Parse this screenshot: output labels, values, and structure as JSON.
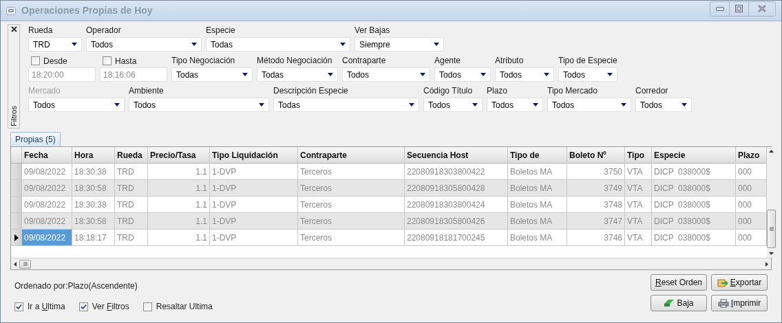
{
  "window": {
    "title": "Operaciones Propias de Hoy"
  },
  "filters": {
    "panel_label": "Filtros",
    "top_row": [
      {
        "kind": "combo",
        "label": "Rueda",
        "value": "TRD"
      },
      {
        "kind": "combo",
        "label": "Operador",
        "value": "Todos"
      },
      {
        "kind": "combo",
        "label": "Especie",
        "value": "Todas"
      },
      {
        "kind": "combo",
        "label": "Ver Bajas",
        "value": "Siempre"
      }
    ],
    "middle_row": [
      {
        "kind": "time",
        "label": "Desde",
        "value": "18:20:00",
        "checked": false
      },
      {
        "kind": "time",
        "label": "Hasta",
        "value": "18:16:06",
        "checked": false
      },
      {
        "kind": "combo",
        "label": "Tipo Negociación",
        "value": "Todas"
      },
      {
        "kind": "combo",
        "label": "Método Negociación",
        "value": "Todas"
      },
      {
        "kind": "combo",
        "label": "Contraparte",
        "value": "Todos"
      },
      {
        "kind": "combo",
        "label": "Agente",
        "value": "Todos"
      },
      {
        "kind": "combo",
        "label": "Atributo",
        "value": "Todos"
      },
      {
        "kind": "combo",
        "label": "Tipo de Especie",
        "value": "Todos"
      }
    ],
    "bottom_row": [
      {
        "kind": "combo",
        "label": "Mercado",
        "value": "Todos",
        "disabled": true
      },
      {
        "kind": "combo",
        "label": "Ambiente",
        "value": "Todos",
        "disabled": false
      },
      {
        "kind": "combo",
        "label": "Descripción Especie",
        "value": "Todas",
        "disabled": false
      },
      {
        "kind": "combo",
        "label": "Código Título",
        "value": "Todos",
        "disabled": false
      },
      {
        "kind": "combo",
        "label": "Plazo",
        "value": "Todos",
        "disabled": false
      },
      {
        "kind": "combo",
        "label": "Tipo Mercado",
        "value": "Todos",
        "disabled": false
      },
      {
        "kind": "combo",
        "label": "Corredor",
        "value": "Todos",
        "disabled": false
      }
    ]
  },
  "tabs": [
    {
      "label": "Propias (5)",
      "selected": true
    }
  ],
  "table": {
    "columns": [
      "Fecha",
      "Hora",
      "Rueda",
      "Precio/Tasa",
      "Tipo Liquidación",
      "Contraparte",
      "Secuencia Host",
      "Tipo de",
      "Boleto Nº",
      "Tipo",
      "Especie",
      "Plazo"
    ],
    "rows": [
      {
        "current": false,
        "cells": [
          "09/08/2022",
          "18:30:38",
          "TRD",
          "1.1",
          "1-DVP",
          "Terceros",
          "22080918303800422",
          "Boletos MA",
          "3750",
          "VTA",
          "DICP  038000$",
          "000"
        ]
      },
      {
        "current": false,
        "cells": [
          "09/08/2022",
          "18:30:58",
          "TRD",
          "1.1",
          "1-DVP",
          "Terceros",
          "22080918305800428",
          "Boletos MA",
          "3749",
          "VTA",
          "DICP  038000$",
          "000"
        ]
      },
      {
        "current": false,
        "cells": [
          "09/08/2022",
          "18:30:38",
          "TRD",
          "1.1",
          "1-DVP",
          "Terceros",
          "22080918303800424",
          "Boletos MA",
          "3748",
          "VTA",
          "DICP  038000$",
          "000"
        ]
      },
      {
        "current": false,
        "cells": [
          "09/08/2022",
          "18:30:58",
          "TRD",
          "1.1",
          "1-DVP",
          "Terceros",
          "22080918305800426",
          "Boletos MA",
          "3747",
          "VTA",
          "DICP  038000$",
          "000"
        ]
      },
      {
        "current": true,
        "cells": [
          "09/08/2022",
          "18:18:17",
          "TRD",
          "1.1",
          "1-DVP",
          "Terceros",
          "22080918181700245",
          "Boletos MA",
          "3746",
          "VTA",
          "DICP  038000$",
          "000"
        ]
      }
    ]
  },
  "footer": {
    "sort_text": "Ordenado por:Plazo(Ascendente)",
    "checkboxes": [
      {
        "label": "Ir a Ultima",
        "checked": true
      },
      {
        "label": "Ver Filtros",
        "checked": true
      },
      {
        "label": "Resaltar Ultima",
        "checked": false
      }
    ],
    "buttons": [
      [
        {
          "kind": "text",
          "label": "Reset Orden"
        },
        {
          "kind": "export",
          "label": "Exportar"
        }
      ],
      [
        {
          "kind": "delete",
          "label": "Baja"
        },
        {
          "kind": "print",
          "label": "Imprimir"
        }
      ]
    ]
  }
}
